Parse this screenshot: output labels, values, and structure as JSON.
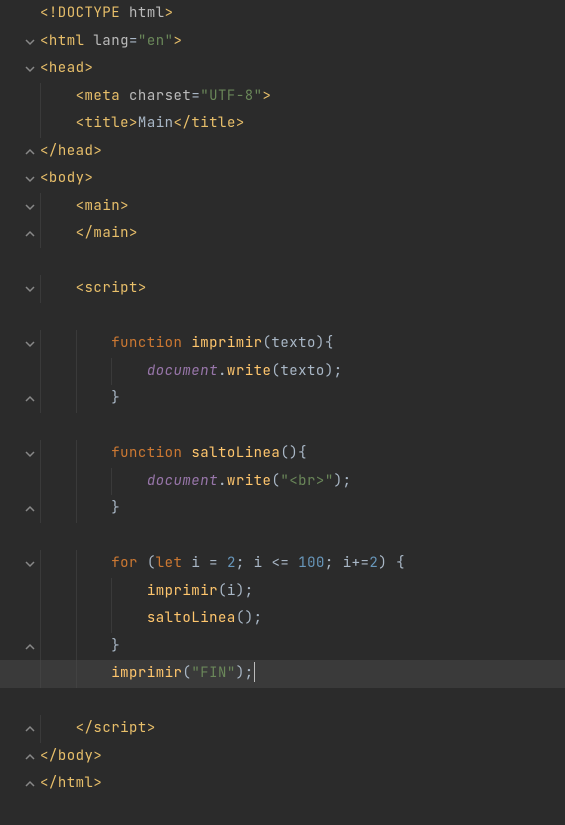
{
  "editor": {
    "lines": [
      {
        "indent": 0,
        "fold": "none",
        "tokens": [
          [
            "c-angle",
            "<"
          ],
          [
            "c-tag",
            "!DOCTYPE "
          ],
          [
            "c-attr",
            "html"
          ],
          [
            "c-angle",
            ">"
          ]
        ]
      },
      {
        "indent": 0,
        "fold": "open",
        "tokens": [
          [
            "c-angle",
            "<"
          ],
          [
            "c-tag",
            "html "
          ],
          [
            "c-attr",
            "lang"
          ],
          [
            "c-eq",
            "="
          ],
          [
            "c-str",
            "\"en\""
          ],
          [
            "c-angle",
            ">"
          ]
        ]
      },
      {
        "indent": 0,
        "fold": "open",
        "tokens": [
          [
            "c-angle",
            "<"
          ],
          [
            "c-tag",
            "head"
          ],
          [
            "c-angle",
            ">"
          ]
        ]
      },
      {
        "indent": 1,
        "fold": "none",
        "tokens": [
          [
            "c-angle",
            "<"
          ],
          [
            "c-tag",
            "meta "
          ],
          [
            "c-attr",
            "charset"
          ],
          [
            "c-eq",
            "="
          ],
          [
            "c-str",
            "\"UTF-8\""
          ],
          [
            "c-angle",
            ">"
          ]
        ]
      },
      {
        "indent": 1,
        "fold": "none",
        "tokens": [
          [
            "c-angle",
            "<"
          ],
          [
            "c-tag",
            "title"
          ],
          [
            "c-angle",
            ">"
          ],
          [
            "c-txt",
            "Main"
          ],
          [
            "c-angle",
            "</"
          ],
          [
            "c-tag",
            "title"
          ],
          [
            "c-angle",
            ">"
          ]
        ]
      },
      {
        "indent": 0,
        "fold": "close",
        "tokens": [
          [
            "c-angle",
            "</"
          ],
          [
            "c-tag",
            "head"
          ],
          [
            "c-angle",
            ">"
          ]
        ]
      },
      {
        "indent": 0,
        "fold": "open",
        "tokens": [
          [
            "c-angle",
            "<"
          ],
          [
            "c-tag",
            "body"
          ],
          [
            "c-angle",
            ">"
          ]
        ]
      },
      {
        "indent": 1,
        "fold": "open",
        "tokens": [
          [
            "c-angle",
            "<"
          ],
          [
            "c-tag",
            "main"
          ],
          [
            "c-angle",
            ">"
          ]
        ]
      },
      {
        "indent": 1,
        "fold": "close",
        "tokens": [
          [
            "c-angle",
            "</"
          ],
          [
            "c-tag",
            "main"
          ],
          [
            "c-angle",
            ">"
          ]
        ]
      },
      {
        "indent": 0,
        "fold": "none",
        "tokens": []
      },
      {
        "indent": 1,
        "fold": "open",
        "tokens": [
          [
            "c-angle",
            "<"
          ],
          [
            "c-tag",
            "script"
          ],
          [
            "c-angle",
            ">"
          ]
        ]
      },
      {
        "indent": 0,
        "fold": "none",
        "tokens": []
      },
      {
        "indent": 2,
        "fold": "open",
        "tokens": [
          [
            "c-kw",
            "function "
          ],
          [
            "c-fn",
            "imprimir"
          ],
          [
            "c-punct",
            "("
          ],
          [
            "c-param",
            "texto"
          ],
          [
            "c-punct",
            ")"
          ],
          [
            "c-brace",
            "{"
          ]
        ]
      },
      {
        "indent": 3,
        "fold": "none",
        "tokens": [
          [
            "c-obj",
            "document"
          ],
          [
            "c-punct",
            "."
          ],
          [
            "c-method",
            "write"
          ],
          [
            "c-punct",
            "("
          ],
          [
            "c-id",
            "texto"
          ],
          [
            "c-punct",
            ")"
          ],
          [
            "c-punct",
            ";"
          ]
        ]
      },
      {
        "indent": 2,
        "fold": "close",
        "tokens": [
          [
            "c-brace",
            "}"
          ]
        ]
      },
      {
        "indent": 0,
        "fold": "none",
        "tokens": []
      },
      {
        "indent": 2,
        "fold": "open",
        "tokens": [
          [
            "c-kw",
            "function "
          ],
          [
            "c-fn",
            "saltoLinea"
          ],
          [
            "c-punct",
            "()"
          ],
          [
            "c-brace",
            "{"
          ]
        ]
      },
      {
        "indent": 3,
        "fold": "none",
        "tokens": [
          [
            "c-obj",
            "document"
          ],
          [
            "c-punct",
            "."
          ],
          [
            "c-method",
            "write"
          ],
          [
            "c-punct",
            "("
          ],
          [
            "c-str",
            "\"<br>\""
          ],
          [
            "c-punct",
            ")"
          ],
          [
            "c-punct",
            ";"
          ]
        ]
      },
      {
        "indent": 2,
        "fold": "close",
        "tokens": [
          [
            "c-brace",
            "}"
          ]
        ]
      },
      {
        "indent": 0,
        "fold": "none",
        "tokens": []
      },
      {
        "indent": 2,
        "fold": "open",
        "tokens": [
          [
            "c-kw",
            "for "
          ],
          [
            "c-punct",
            "("
          ],
          [
            "c-kw",
            "let "
          ],
          [
            "c-id",
            "i "
          ],
          [
            "c-op",
            "= "
          ],
          [
            "c-num",
            "2"
          ],
          [
            "c-punct",
            "; "
          ],
          [
            "c-id",
            "i "
          ],
          [
            "c-op",
            "<= "
          ],
          [
            "c-num",
            "100"
          ],
          [
            "c-punct",
            "; "
          ],
          [
            "c-id",
            "i"
          ],
          [
            "c-op",
            "+="
          ],
          [
            "c-num",
            "2"
          ],
          [
            "c-punct",
            ") "
          ],
          [
            "c-brace",
            "{"
          ]
        ]
      },
      {
        "indent": 3,
        "fold": "none",
        "tokens": [
          [
            "c-fn",
            "imprimir"
          ],
          [
            "c-punct",
            "("
          ],
          [
            "c-id",
            "i"
          ],
          [
            "c-punct",
            ")"
          ],
          [
            "c-punct",
            ";"
          ]
        ]
      },
      {
        "indent": 3,
        "fold": "none",
        "tokens": [
          [
            "c-fn",
            "saltoLinea"
          ],
          [
            "c-punct",
            "("
          ],
          [
            "c-punct",
            ")"
          ],
          [
            "c-punct",
            ";"
          ]
        ]
      },
      {
        "indent": 2,
        "fold": "close",
        "tokens": [
          [
            "c-brace",
            "}"
          ]
        ]
      },
      {
        "indent": 2,
        "fold": "none",
        "highlight": true,
        "cursor": true,
        "tokens": [
          [
            "c-fn",
            "imprimir"
          ],
          [
            "c-punct",
            "("
          ],
          [
            "c-str",
            "\"FIN\""
          ],
          [
            "c-punct",
            ")"
          ],
          [
            "c-punct",
            ";"
          ]
        ]
      },
      {
        "indent": 0,
        "fold": "none",
        "tokens": []
      },
      {
        "indent": 1,
        "fold": "close",
        "tokens": [
          [
            "c-angle",
            "</"
          ],
          [
            "c-tag",
            "script"
          ],
          [
            "c-angle",
            ">"
          ]
        ]
      },
      {
        "indent": 0,
        "fold": "close",
        "tokens": [
          [
            "c-angle",
            "</"
          ],
          [
            "c-tag",
            "body"
          ],
          [
            "c-angle",
            ">"
          ]
        ]
      },
      {
        "indent": 0,
        "fold": "close",
        "tokens": [
          [
            "c-angle",
            "</"
          ],
          [
            "c-tag",
            "html"
          ],
          [
            "c-angle",
            ">"
          ]
        ]
      }
    ],
    "indentUnit": "    ",
    "guides": {
      "guideColor": "#4a4a4a"
    }
  }
}
